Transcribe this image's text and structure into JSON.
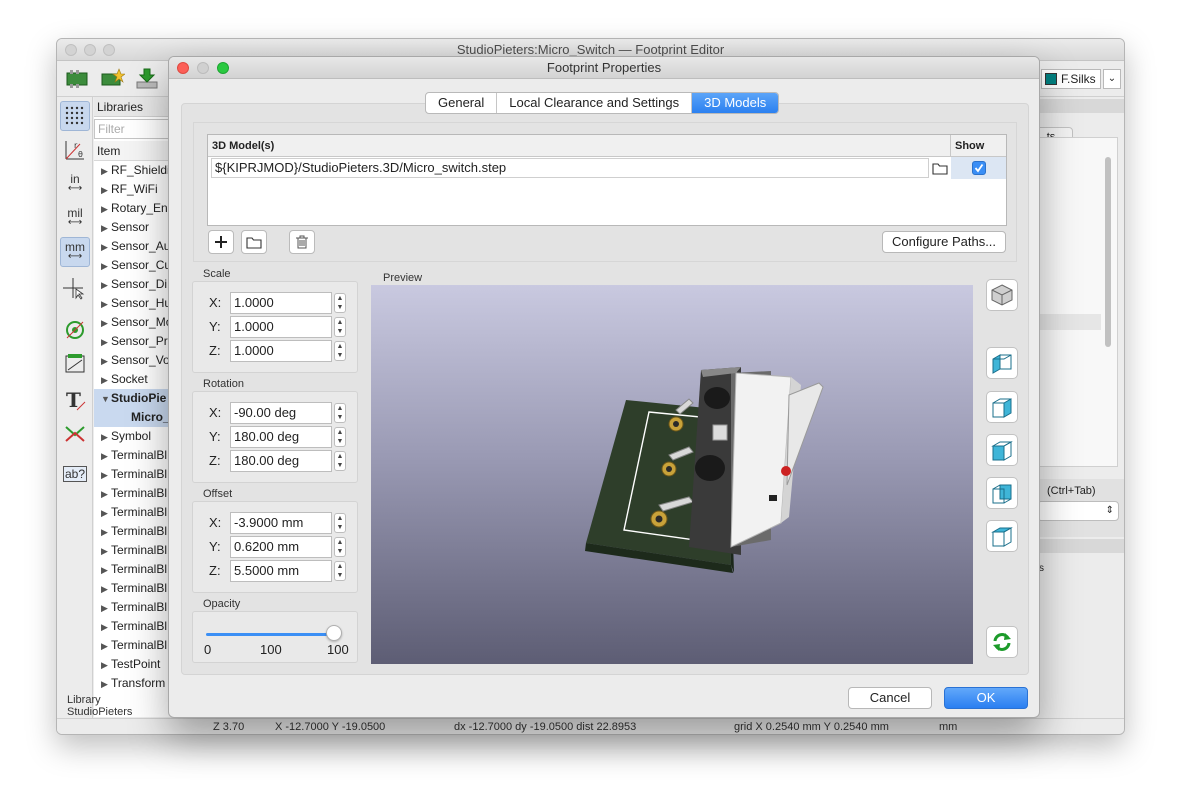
{
  "main_window": {
    "title": "StudioPieters:Micro_Switch — Footprint Editor",
    "layer_selector": "F.Silks",
    "libraries": {
      "header": "Libraries",
      "filter_placeholder": "Filter",
      "column": "Item",
      "items": [
        {
          "label": "RF_Shieldi",
          "expanded": false
        },
        {
          "label": "RF_WiFi",
          "expanded": false
        },
        {
          "label": "Rotary_Enc",
          "expanded": false
        },
        {
          "label": "Sensor",
          "expanded": false
        },
        {
          "label": "Sensor_Au",
          "expanded": false
        },
        {
          "label": "Sensor_Cu",
          "expanded": false
        },
        {
          "label": "Sensor_Di",
          "expanded": false
        },
        {
          "label": "Sensor_Hu",
          "expanded": false
        },
        {
          "label": "Sensor_Mo",
          "expanded": false
        },
        {
          "label": "Sensor_Pr",
          "expanded": false
        },
        {
          "label": "Sensor_Vo",
          "expanded": false
        },
        {
          "label": "Socket",
          "expanded": false
        },
        {
          "label": "StudioPie",
          "expanded": true
        },
        {
          "label": "Micro_",
          "child": true
        },
        {
          "label": "Symbol",
          "expanded": false
        },
        {
          "label": "TerminalBl",
          "expanded": false
        },
        {
          "label": "TerminalBl",
          "expanded": false
        },
        {
          "label": "TerminalBl",
          "expanded": false
        },
        {
          "label": "TerminalBl",
          "expanded": false
        },
        {
          "label": "TerminalBl",
          "expanded": false
        },
        {
          "label": "TerminalBl",
          "expanded": false
        },
        {
          "label": "TerminalBl",
          "expanded": false
        },
        {
          "label": "TerminalBl",
          "expanded": false
        },
        {
          "label": "TerminalBl",
          "expanded": false
        },
        {
          "label": "TerminalBl",
          "expanded": false
        },
        {
          "label": "TerminalBl",
          "expanded": false
        },
        {
          "label": "TestPoint",
          "expanded": false
        },
        {
          "label": "Transform",
          "expanded": false
        }
      ],
      "footer_label": "Library",
      "footer_value": "StudioPieters"
    },
    "left_tools": {
      "inch": "in",
      "mil": "mil",
      "mm": "mm",
      "text_tool": "ab?"
    },
    "status": {
      "zoom": "Z 3.70",
      "xy": "X -12.7000  Y -19.0500",
      "delta": "dx -12.7000  dy -19.0500  dist 22.8953",
      "grid": "grid X 0.2540 mm  Y 0.2540 mm",
      "units": "mm"
    },
    "right_panel": {
      "tab_fragment": "ts",
      "hotkey": "(Ctrl+Tab)",
      "fragment_s": "s"
    }
  },
  "dialog": {
    "title": "Footprint Properties",
    "tabs": [
      {
        "label": "General",
        "active": false
      },
      {
        "label": "Local Clearance and Settings",
        "active": false
      },
      {
        "label": "3D Models",
        "active": true
      }
    ],
    "models_table": {
      "col_model": "3D Model(s)",
      "col_show": "Show",
      "rows": [
        {
          "path": "${KIPRJMOD}/StudioPieters.3D/Micro_switch.step",
          "show": true
        }
      ]
    },
    "configure_paths": "Configure Paths...",
    "scale": {
      "label": "Scale",
      "x": "1.0000",
      "y": "1.0000",
      "z": "1.0000"
    },
    "rotation": {
      "label": "Rotation",
      "x": "-90.00 deg",
      "y": "180.00 deg",
      "z": "180.00 deg"
    },
    "offset": {
      "label": "Offset",
      "x": "-3.9000 mm",
      "y": "0.6200 mm",
      "z": "5.5000 mm"
    },
    "axis_labels": {
      "x": "X:",
      "y": "Y:",
      "z": "Z:"
    },
    "opacity": {
      "label": "Opacity",
      "min_label": "0",
      "mid_label": "100",
      "value_label": "100",
      "value": 1.0
    },
    "preview_label": "Preview",
    "cancel": "Cancel",
    "ok": "OK",
    "colors": {
      "accent": "#2b80f0",
      "pcb": "#2f3f2c",
      "silk_outline": "#ffffff",
      "pad": "#c8a23a"
    }
  }
}
